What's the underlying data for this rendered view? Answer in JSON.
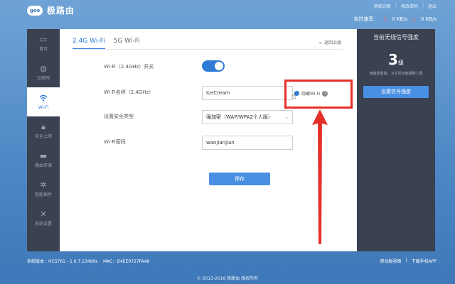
{
  "header": {
    "logo_badge": "gee",
    "logo_text": "极路由",
    "links": [
      "网络诊断",
      "修改密码",
      "退出"
    ],
    "speed_label": "实时速率：",
    "upload": "0 KB/s",
    "download": "0 KB/s"
  },
  "sidebar": {
    "items": [
      {
        "label": "首页",
        "icon": "monitor-icon"
      },
      {
        "label": "互联网",
        "icon": "globe-icon"
      },
      {
        "label": "Wi-Fi",
        "icon": "wifi-icon"
      },
      {
        "label": "安全上网",
        "icon": "lock-icon"
      },
      {
        "label": "路由存储",
        "icon": "folder-icon"
      },
      {
        "label": "智能插件",
        "icon": "plugin-icon"
      },
      {
        "label": "系统设置",
        "icon": "wrench-icon"
      }
    ]
  },
  "tabs": [
    "2.4G Wi-Fi",
    "5G Wi-Fi"
  ],
  "back_link": "返回上级",
  "form": {
    "switch_label": "Wi-Fi（2.4GHz）开关",
    "switch_on": true,
    "name_label": "Wi-Fi名称（2.4GHz）",
    "name_value": "IceCream",
    "hide_wifi_label": "隐藏Wi-Fi",
    "security_label": "设置安全类型",
    "security_value": "强加密（WAP/WPA2个人版）",
    "password_label": "Wi-Fi密码",
    "password_value": "wanjianjian",
    "save_label": "保存"
  },
  "right_panel": {
    "title": "当前无线信号强度",
    "level_num": "3",
    "level_unit": "级",
    "desc": "穿越承重墙，卫生间也能顺畅上网",
    "button": "设置信号强度"
  },
  "footer": {
    "version": "系统版本：HC5761 - 1.0.7.13499s",
    "mac": "MAC：D4EE0727FA46",
    "link_mobile_ui": "移动版界面",
    "link_app": "下载手机APP",
    "copyright": "© 2013-2016 极路由 版权所有"
  },
  "colors": {
    "accent": "#2f7bd6",
    "sidebar": "#3a4150",
    "annotation": "#e5302a"
  }
}
